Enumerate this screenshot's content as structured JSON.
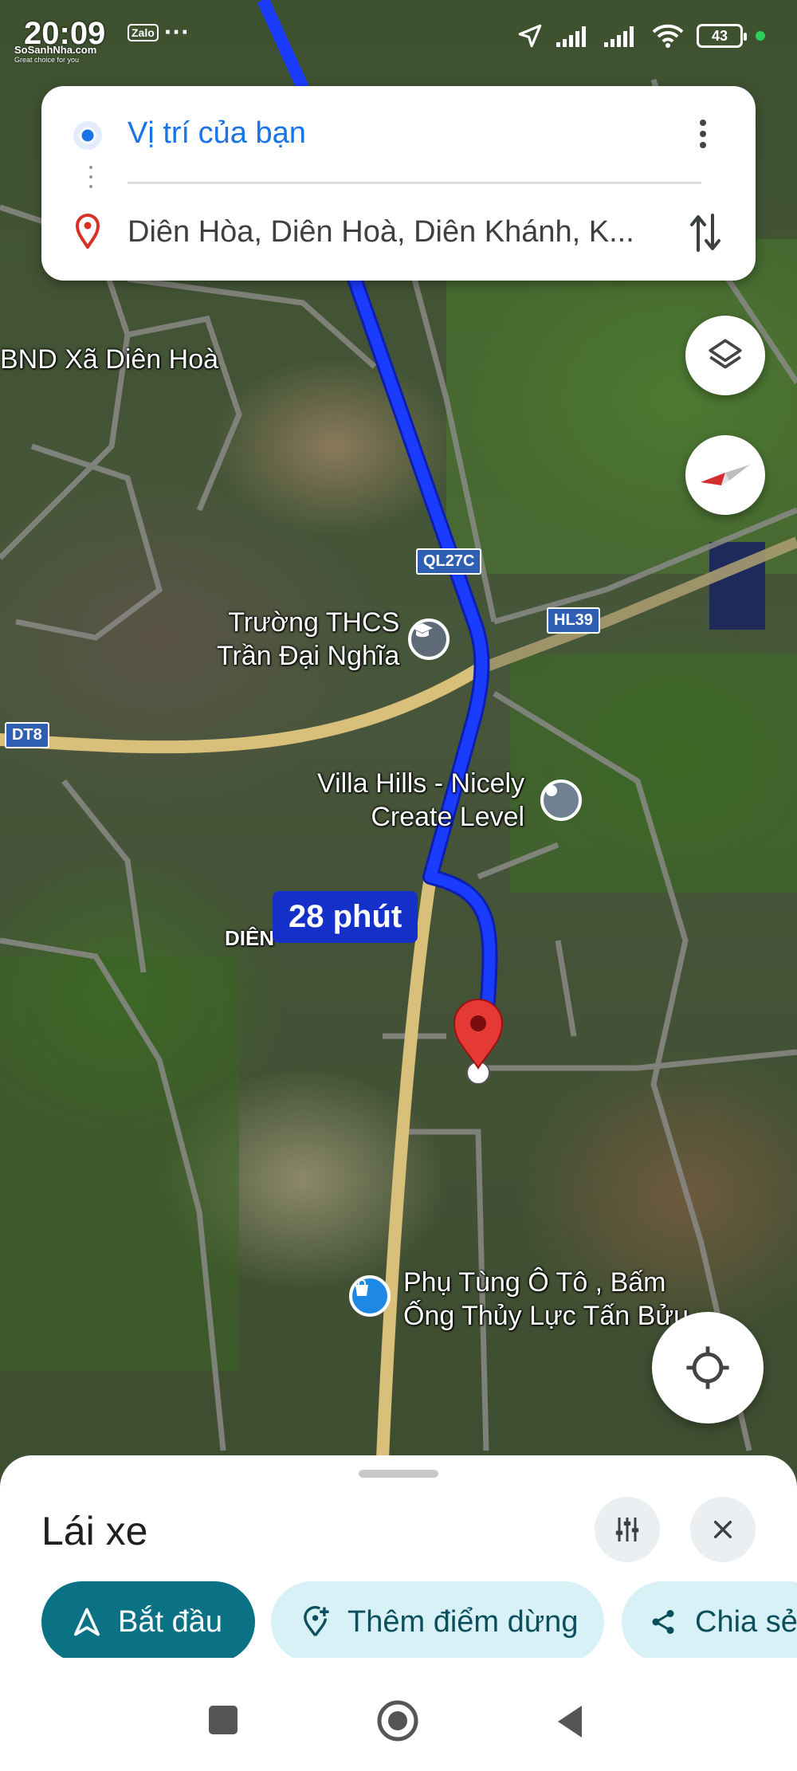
{
  "status_bar": {
    "time": "20:09",
    "watermark": "SoSanhNha.com",
    "watermark_sub": "Great choice for you",
    "notification_app": "Zalo",
    "more": "···",
    "battery": "43"
  },
  "directions": {
    "origin": "Vị trí của bạn",
    "destination": "Diên Hòa, Diên Hoà, Diên Khánh, K..."
  },
  "map": {
    "labels": {
      "ubnd": "BND Xã Diên Hoà",
      "school_line1": "Trường THCS",
      "school_line2": "Trần Đại Nghĩa",
      "villa_line1": "Villa Hills - Nicely",
      "villa_line2": "Create Level",
      "area": "DIÊN",
      "shop_line1": "Phụ Tùng Ô Tô , Bấm",
      "shop_line2": "Ống Thủy Lực Tấn Bửu"
    },
    "shields": {
      "ql27c": "QL27C",
      "hl39": "HL39",
      "dt8": "DT8"
    },
    "route_duration": "28 phút",
    "colors": {
      "route": "#1a3cff",
      "main_road": "#d9c07a",
      "destination_pin": "#e53935"
    }
  },
  "bottom_sheet": {
    "mode_title": "Lái xe",
    "start_label": "Bắt đầu",
    "add_stop_label": "Thêm điểm dừng",
    "share_label": "Chia sẻ",
    "accent": "#0b7285"
  }
}
